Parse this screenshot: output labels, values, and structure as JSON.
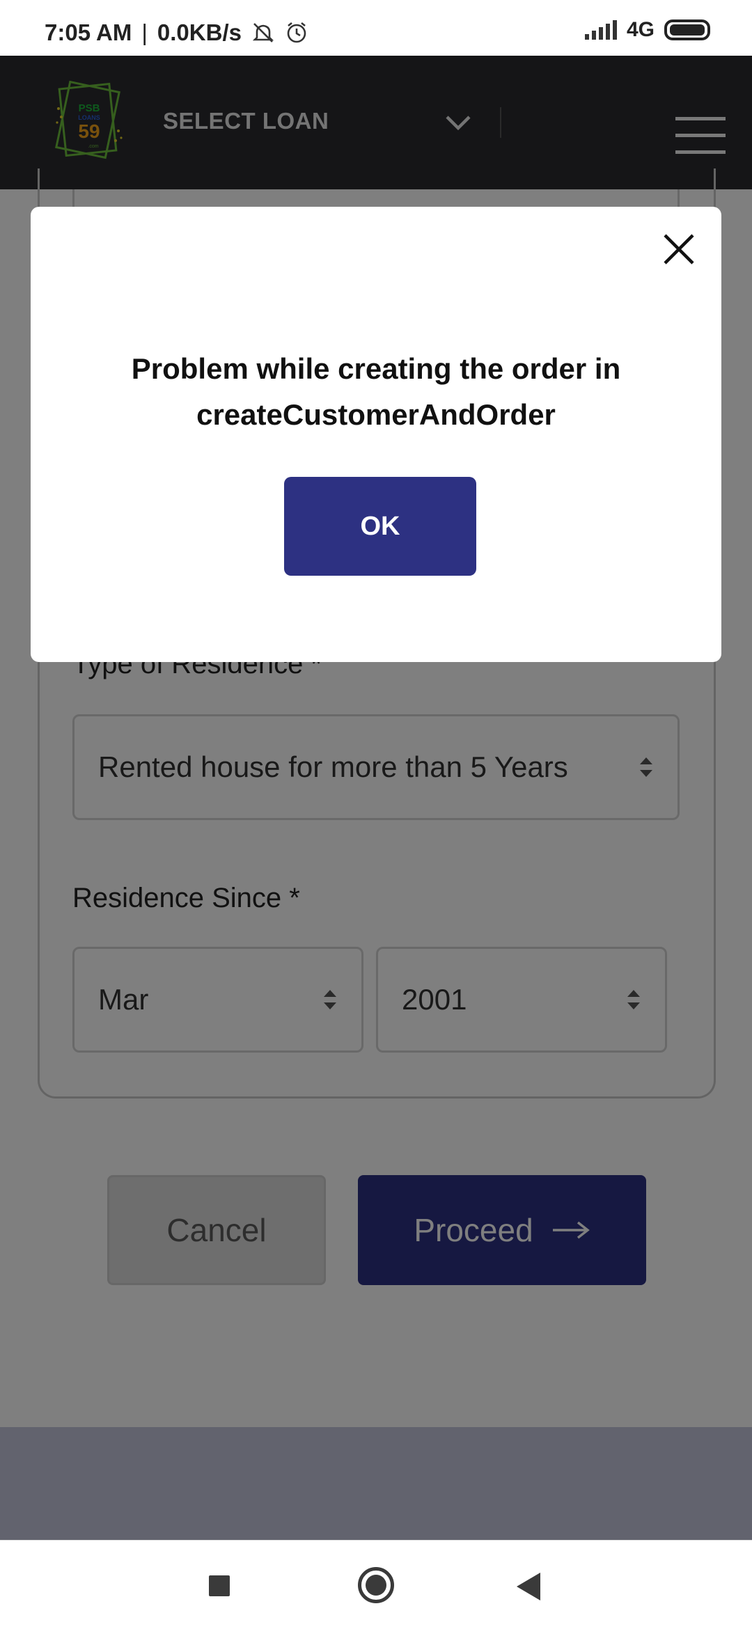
{
  "status_bar": {
    "time": "7:05 AM",
    "separator": "|",
    "net_speed": "0.0KB/s",
    "network": "4G"
  },
  "header": {
    "logo_icon": "psb-loans-59-logo",
    "select_loan": "SELECT LOAN"
  },
  "form": {
    "residence_type_label": "Type of Residence *",
    "residence_type_value": "Rented house for more than 5 Years",
    "residence_since_label": "Residence Since *",
    "month_value": "Mar",
    "year_value": "2001",
    "cancel_label": "Cancel",
    "proceed_label": "Proceed"
  },
  "modal": {
    "message_line1": "Problem while creating the order in",
    "message_line2": "createCustomerAndOrder",
    "ok_label": "OK"
  },
  "colors": {
    "header_bg": "#2a2b2e",
    "primary_button": "#2d3182",
    "overlay": "rgba(0,0,0,0.5)"
  }
}
